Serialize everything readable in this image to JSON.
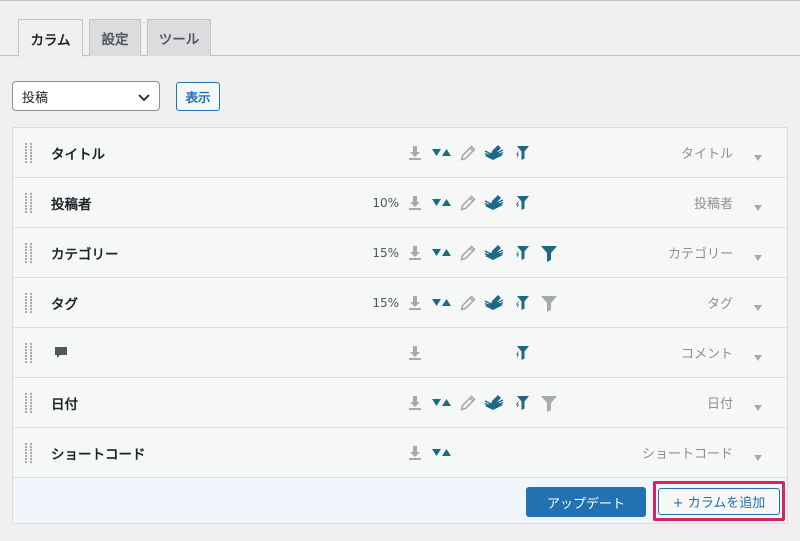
{
  "tabs": [
    {
      "label": "カラム",
      "active": true
    },
    {
      "label": "設定",
      "active": false
    },
    {
      "label": "ツール",
      "active": false
    }
  ],
  "post_type_select": {
    "value": "投稿"
  },
  "show_button": "表示",
  "columns": [
    {
      "label": "タイトル",
      "width": "",
      "type": "タイトル",
      "icons": [
        "download-icon",
        "sort-icon",
        "edit-icon",
        "bulk-edit-icon",
        "smart-filter-icon"
      ],
      "filter": ""
    },
    {
      "label": "投稿者",
      "width": "10%",
      "type": "投稿者",
      "icons": [
        "download-icon",
        "sort-icon",
        "edit-icon",
        "bulk-edit-icon",
        "smart-filter-icon"
      ],
      "filter": ""
    },
    {
      "label": "カテゴリー",
      "width": "15%",
      "type": "カテゴリー",
      "icons": [
        "download-icon",
        "sort-icon",
        "edit-icon",
        "bulk-edit-icon",
        "smart-filter-icon",
        "filter-icon"
      ],
      "filter": "active"
    },
    {
      "label": "タグ",
      "width": "15%",
      "type": "タグ",
      "icons": [
        "download-icon",
        "sort-icon",
        "edit-icon",
        "bulk-edit-icon",
        "smart-filter-icon",
        "filter-icon"
      ],
      "filter": "inactive"
    },
    {
      "label": "",
      "width": "",
      "type": "コメント",
      "icons": [
        "download-icon",
        "smart-filter-icon"
      ],
      "filter": "",
      "label_icon": "comment-icon"
    },
    {
      "label": "日付",
      "width": "",
      "type": "日付",
      "icons": [
        "download-icon",
        "sort-icon",
        "edit-icon",
        "bulk-edit-icon",
        "smart-filter-icon",
        "filter-icon"
      ],
      "filter": "inactive"
    },
    {
      "label": "ショートコード",
      "width": "",
      "type": "ショートコード",
      "icons": [
        "download-icon",
        "sort-icon"
      ],
      "filter": ""
    }
  ],
  "footer": {
    "update_button": "アップデート",
    "add_column_button": "+ カラムを追加"
  },
  "colors": {
    "accent": "#2271b1",
    "highlight": "#d9235e",
    "icon_teal": "#1d6987",
    "icon_gray": "#a7aaad"
  }
}
